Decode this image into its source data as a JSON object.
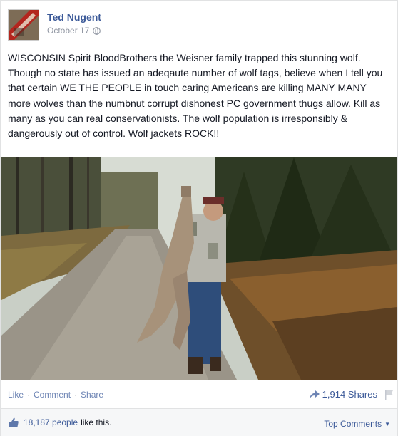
{
  "post": {
    "author": "Ted Nugent",
    "date": "October 17",
    "body": "WISCONSIN Spirit BloodBrothers the Weisner family trapped this stunning wolf. Though no state has issued an adeqaute number of wolf tags, believe when I tell you that certain WE THE PEOPLE in touch caring Americans are killing MANY MANY more wolves than the numbnut corrupt dishonest PC government thugs allow. Kill as many as you can real conservationists. The wolf population is irresponsibly & dangerously out of control. Wolf jackets ROCK!!"
  },
  "actions": {
    "like": "Like",
    "comment": "Comment",
    "share": "Share",
    "separator": "·",
    "shares_count": "1,914 Shares"
  },
  "likes_bar": {
    "count": "18,187 people",
    "suffix": "like this.",
    "top_comments": "Top Comments"
  },
  "icons": {
    "privacy": "globe-icon",
    "share": "share-arrow-icon",
    "report": "flag-icon",
    "like": "thumbs-up-icon",
    "sort": "caret-down-icon"
  },
  "colors": {
    "link": "#3b5998",
    "action_link": "#6d84b4",
    "meta": "#9197a3",
    "bar_bg": "#f6f7f8"
  }
}
